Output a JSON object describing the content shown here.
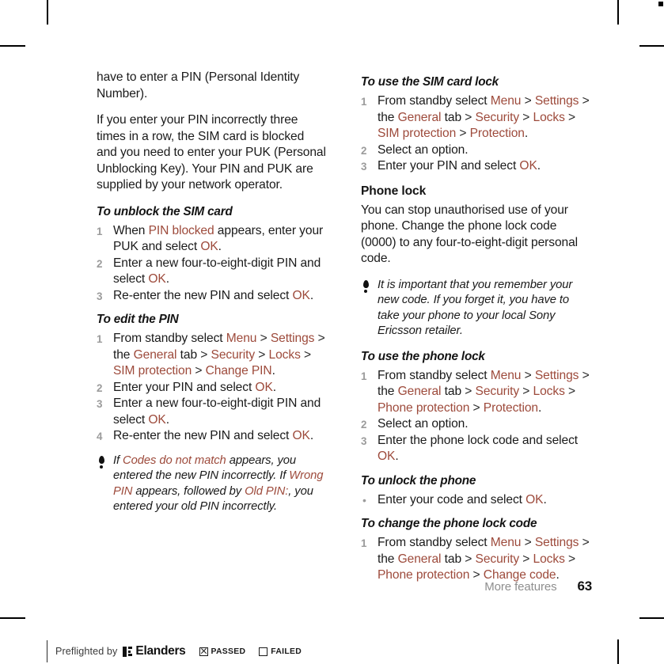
{
  "document": {
    "chapter": "More features",
    "page_number": "63"
  },
  "accent_color": "#9d4a3b",
  "left_column": {
    "paragraphs": [
      "have to enter a PIN (Personal Identity Number).",
      "If you enter your PIN incorrectly three times in a row, the SIM card is blocked and you need to enter your PUK (Personal Unblocking Key). Your PIN and PUK are supplied by your network operator."
    ],
    "procedures": [
      {
        "title": "To unblock the SIM card",
        "steps": [
          [
            {
              "t": "When ",
              "k": "plain"
            },
            {
              "t": "PIN blocked",
              "k": "ui"
            },
            {
              "t": " appears, enter your PUK and select ",
              "k": "plain"
            },
            {
              "t": "OK",
              "k": "ui"
            },
            {
              "t": ".",
              "k": "plain"
            }
          ],
          [
            {
              "t": "Enter a new four-to-eight-digit PIN and select ",
              "k": "plain"
            },
            {
              "t": "OK",
              "k": "ui"
            },
            {
              "t": ".",
              "k": "plain"
            }
          ],
          [
            {
              "t": "Re-enter the new PIN and select ",
              "k": "plain"
            },
            {
              "t": "OK",
              "k": "ui"
            },
            {
              "t": ".",
              "k": "plain"
            }
          ]
        ]
      },
      {
        "title": "To edit the PIN",
        "steps": [
          [
            {
              "t": "From standby select ",
              "k": "plain"
            },
            {
              "t": "Menu",
              "k": "ui"
            },
            {
              "t": " > ",
              "k": "sep"
            },
            {
              "t": "Settings",
              "k": "ui"
            },
            {
              "t": " > ",
              "k": "sep"
            },
            {
              "t": "the ",
              "k": "plain"
            },
            {
              "t": "General",
              "k": "ui"
            },
            {
              "t": " tab",
              "k": "plain"
            },
            {
              "t": " > ",
              "k": "sep"
            },
            {
              "t": "Security",
              "k": "ui"
            },
            {
              "t": " > ",
              "k": "sep"
            },
            {
              "t": "Locks",
              "k": "ui"
            },
            {
              "t": " > ",
              "k": "sep"
            },
            {
              "t": "SIM protection",
              "k": "ui"
            },
            {
              "t": " > ",
              "k": "sep"
            },
            {
              "t": "Change PIN",
              "k": "ui"
            },
            {
              "t": ".",
              "k": "plain"
            }
          ],
          [
            {
              "t": "Enter your PIN and select ",
              "k": "plain"
            },
            {
              "t": "OK",
              "k": "ui"
            },
            {
              "t": ".",
              "k": "plain"
            }
          ],
          [
            {
              "t": "Enter a new four-to-eight-digit PIN and select ",
              "k": "plain"
            },
            {
              "t": "OK",
              "k": "ui"
            },
            {
              "t": ".",
              "k": "plain"
            }
          ],
          [
            {
              "t": "Re-enter the new PIN and select ",
              "k": "plain"
            },
            {
              "t": "OK",
              "k": "ui"
            },
            {
              "t": ".",
              "k": "plain"
            }
          ]
        ]
      }
    ],
    "note": {
      "icon": "exclamation-note-icon",
      "runs": [
        {
          "t": "If ",
          "k": "plain"
        },
        {
          "t": "Codes do not match",
          "k": "ui"
        },
        {
          "t": " appears, you entered the new PIN incorrectly. If ",
          "k": "plain"
        },
        {
          "t": "Wrong PIN",
          "k": "ui"
        },
        {
          "t": " appears, followed by ",
          "k": "plain"
        },
        {
          "t": "Old PIN:",
          "k": "ui"
        },
        {
          "t": ", you entered your old PIN incorrectly.",
          "k": "plain"
        }
      ]
    }
  },
  "right_column": {
    "procedure_sim_lock": {
      "title": "To use the SIM card lock",
      "steps": [
        [
          {
            "t": "From standby select ",
            "k": "plain"
          },
          {
            "t": "Menu",
            "k": "ui"
          },
          {
            "t": " > ",
            "k": "sep"
          },
          {
            "t": "Settings",
            "k": "ui"
          },
          {
            "t": " > ",
            "k": "sep"
          },
          {
            "t": "the ",
            "k": "plain"
          },
          {
            "t": "General",
            "k": "ui"
          },
          {
            "t": " tab",
            "k": "plain"
          },
          {
            "t": " > ",
            "k": "sep"
          },
          {
            "t": "Security",
            "k": "ui"
          },
          {
            "t": " > ",
            "k": "sep"
          },
          {
            "t": "Locks",
            "k": "ui"
          },
          {
            "t": " > ",
            "k": "sep"
          },
          {
            "t": "SIM protection",
            "k": "ui"
          },
          {
            "t": " > ",
            "k": "sep"
          },
          {
            "t": "Protection",
            "k": "ui"
          },
          {
            "t": ".",
            "k": "plain"
          }
        ],
        [
          {
            "t": "Select an option.",
            "k": "plain"
          }
        ],
        [
          {
            "t": "Enter your PIN and select ",
            "k": "plain"
          },
          {
            "t": "OK",
            "k": "ui"
          },
          {
            "t": ".",
            "k": "plain"
          }
        ]
      ]
    },
    "section_phone_lock": {
      "heading": "Phone lock",
      "paragraph": "You can stop unauthorised use of your phone. Change the phone lock code (0000) to any four-to-eight-digit personal code."
    },
    "note": {
      "icon": "exclamation-note-icon",
      "runs": [
        {
          "t": "It is important that you remember your new code. If you forget it, you have to take your phone to your local Sony Ericsson retailer.",
          "k": "plain"
        }
      ]
    },
    "procedure_use_phone_lock": {
      "title": "To use the phone lock",
      "steps": [
        [
          {
            "t": "From standby select ",
            "k": "plain"
          },
          {
            "t": "Menu",
            "k": "ui"
          },
          {
            "t": " > ",
            "k": "sep"
          },
          {
            "t": "Settings",
            "k": "ui"
          },
          {
            "t": " > ",
            "k": "sep"
          },
          {
            "t": "the ",
            "k": "plain"
          },
          {
            "t": "General",
            "k": "ui"
          },
          {
            "t": " tab",
            "k": "plain"
          },
          {
            "t": " > ",
            "k": "sep"
          },
          {
            "t": "Security",
            "k": "ui"
          },
          {
            "t": " > ",
            "k": "sep"
          },
          {
            "t": "Locks",
            "k": "ui"
          },
          {
            "t": " > ",
            "k": "sep"
          },
          {
            "t": "Phone protection",
            "k": "ui"
          },
          {
            "t": " > ",
            "k": "sep"
          },
          {
            "t": "Protection",
            "k": "ui"
          },
          {
            "t": ".",
            "k": "plain"
          }
        ],
        [
          {
            "t": "Select an option.",
            "k": "plain"
          }
        ],
        [
          {
            "t": "Enter the phone lock code and select ",
            "k": "plain"
          },
          {
            "t": "OK",
            "k": "ui"
          },
          {
            "t": ".",
            "k": "plain"
          }
        ]
      ]
    },
    "procedure_unlock_phone": {
      "title": "To unlock the phone",
      "bullets": [
        [
          {
            "t": "Enter your code and select ",
            "k": "plain"
          },
          {
            "t": "OK",
            "k": "ui"
          },
          {
            "t": ".",
            "k": "plain"
          }
        ]
      ]
    },
    "procedure_change_code": {
      "title": "To change the phone lock code",
      "steps": [
        [
          {
            "t": "From standby select ",
            "k": "plain"
          },
          {
            "t": "Menu",
            "k": "ui"
          },
          {
            "t": " > ",
            "k": "sep"
          },
          {
            "t": "Settings",
            "k": "ui"
          },
          {
            "t": " > ",
            "k": "sep"
          },
          {
            "t": "the ",
            "k": "plain"
          },
          {
            "t": "General",
            "k": "ui"
          },
          {
            "t": " tab",
            "k": "plain"
          },
          {
            "t": " > ",
            "k": "sep"
          },
          {
            "t": "Security",
            "k": "ui"
          },
          {
            "t": " > ",
            "k": "sep"
          },
          {
            "t": "Locks",
            "k": "ui"
          },
          {
            "t": " > ",
            "k": "sep"
          },
          {
            "t": "Phone protection",
            "k": "ui"
          },
          {
            "t": " > ",
            "k": "sep"
          },
          {
            "t": "Change code",
            "k": "ui"
          },
          {
            "t": ".",
            "k": "plain"
          }
        ]
      ]
    }
  },
  "preflight": {
    "text": "Preflighted by",
    "brand": "Elanders",
    "passed_label": "PASSED",
    "failed_label": "FAILED",
    "passed_checked": true,
    "failed_checked": false
  }
}
